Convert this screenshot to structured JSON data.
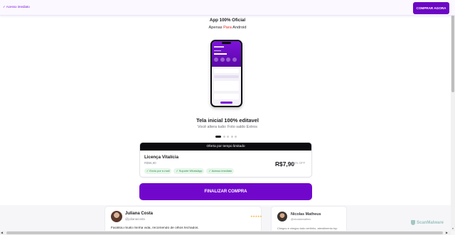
{
  "header": {
    "access_label": "✓ Acesso imediato",
    "buy_label": "COMPRAR AGORA"
  },
  "hero": {
    "title": "App 100% Oficial",
    "subtitle_prefix": "Apenas ",
    "subtitle_highlight": "Para",
    "subtitle_suffix": " Android"
  },
  "slide": {
    "title": "Tela inicial 100% editavel",
    "subtitle": "Você altera tudo: Foto saldo Extros",
    "total_dots": 5,
    "active_dot": 1
  },
  "offer": {
    "banner": "Oferta por tempo limitado",
    "product": "Licença Vitalícia",
    "note": "R$56,90",
    "tags": [
      "✓ Envio por e-mail",
      "✓ Suporte WhatsApp",
      "✓ Acesso imediato"
    ],
    "price": "R$7,90",
    "discount": "86% OFF"
  },
  "cta": {
    "finalize_label": "FINALIZAR COMPRA"
  },
  "testimonials": [
    {
      "name": "Juliana Costa",
      "handle": "@julianacosta",
      "rating": 5,
      "stars": "★★★★★",
      "text": "Facilitou muito minha vida, recomendo de olhos fechados."
    },
    {
      "name": "Nicolas Matheus",
      "handle": "@nicolasmatheu",
      "text": "Chegou e chegou tudo certinho, atendimento top"
    }
  ],
  "watermark": "ScanMalware",
  "colors": {
    "brand_purple": "#7207cc",
    "highlight_red": "#e3262e",
    "tag_green": "#2f8a49",
    "banner_black": "#0b0b10"
  }
}
